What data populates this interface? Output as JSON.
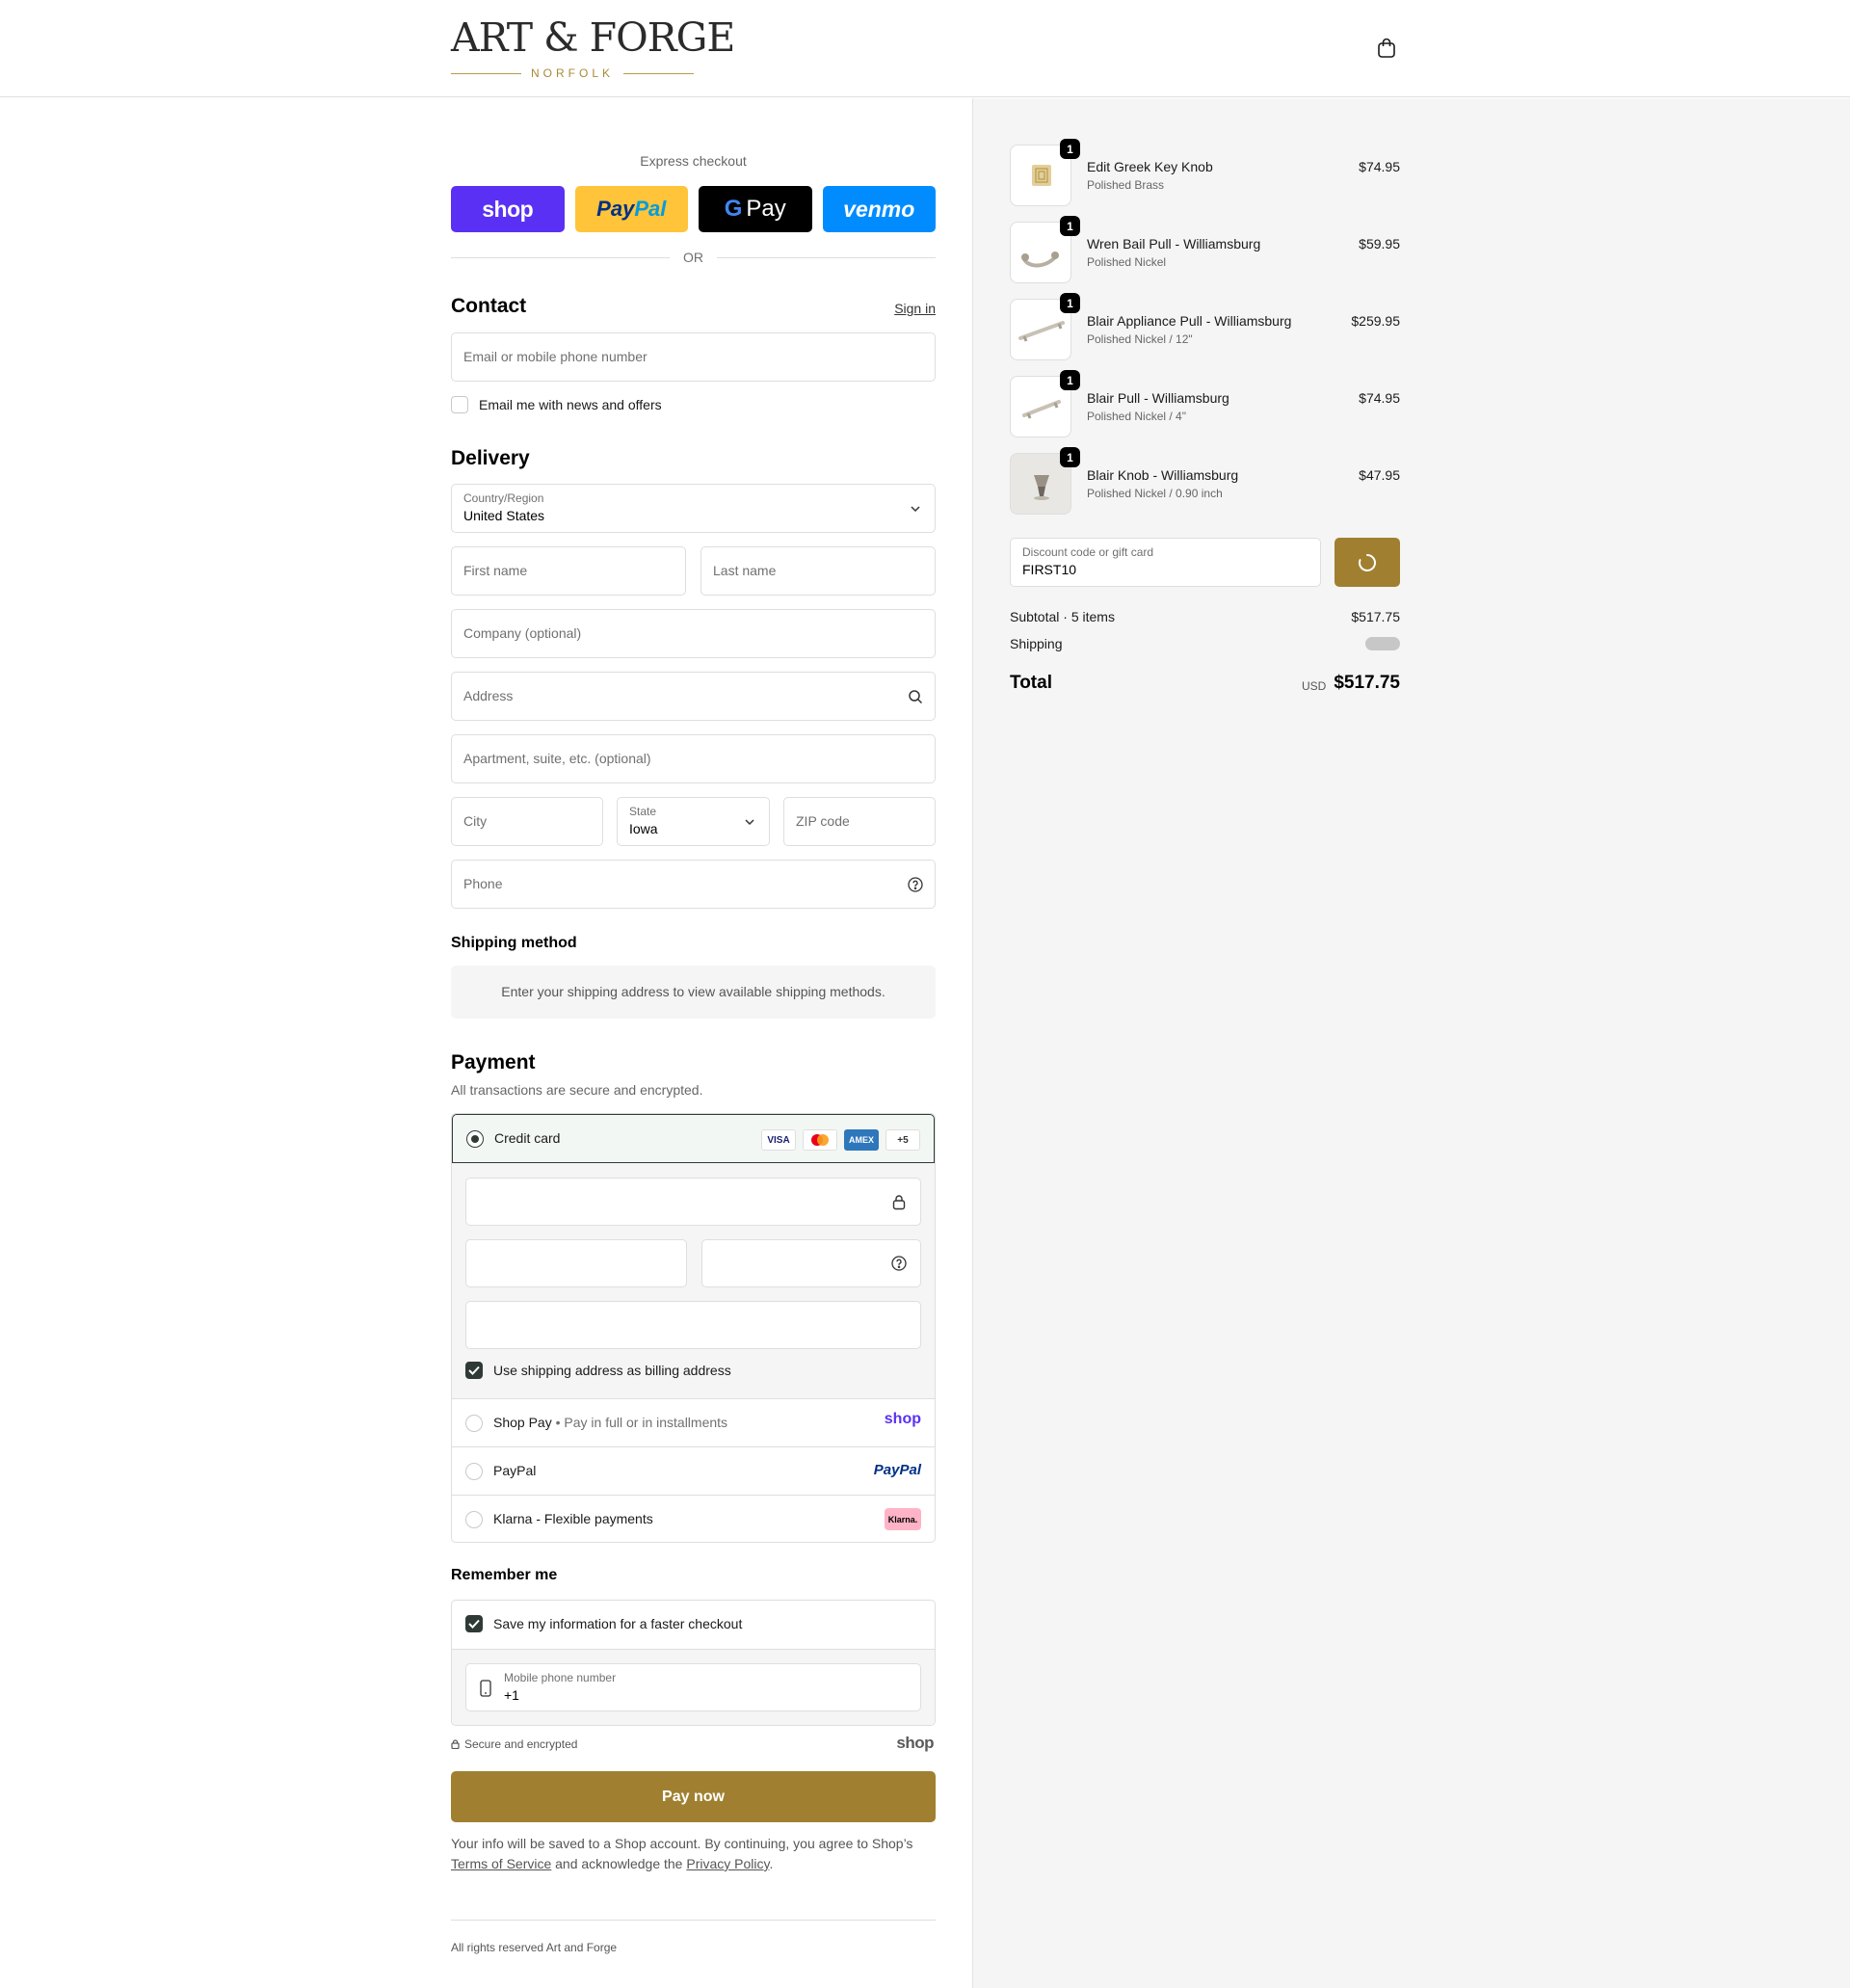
{
  "header": {
    "logo_main": "ART & FORGE",
    "logo_sub": "NORFOLK"
  },
  "express": {
    "title": "Express checkout",
    "buttons": [
      "shop",
      "PayPal",
      "G Pay",
      "venmo"
    ],
    "or": "OR"
  },
  "contact": {
    "title": "Contact",
    "sign_in": "Sign in",
    "email_placeholder": "Email or mobile phone number",
    "news_label": "Email me with news and offers"
  },
  "delivery": {
    "title": "Delivery",
    "country_label": "Country/Region",
    "country_value": "United States",
    "first_name": "First name",
    "last_name": "Last name",
    "company": "Company (optional)",
    "address": "Address",
    "apartment": "Apartment, suite, etc. (optional)",
    "city": "City",
    "state_label": "State",
    "state_value": "Iowa",
    "zip": "ZIP code",
    "phone": "Phone"
  },
  "shipping": {
    "title": "Shipping method",
    "note": "Enter your shipping address to view available shipping methods."
  },
  "payment": {
    "title": "Payment",
    "subtitle": "All transactions are secure and encrypted.",
    "credit_card": "Credit card",
    "card_brands": [
      "VISA",
      "MC",
      "AMEX",
      "+5"
    ],
    "billing_label": "Use shipping address as billing address",
    "shop_pay": "Shop Pay",
    "shop_pay_sub": "Pay in full or in installments",
    "shop_pay_logo": "shop",
    "paypal": "PayPal",
    "paypal_logo": "PayPal",
    "klarna": "Klarna - Flexible payments",
    "klarna_logo": "Klarna."
  },
  "remember": {
    "title": "Remember me",
    "save_label": "Save my information for a faster checkout",
    "mobile_label": "Mobile phone number",
    "mobile_value": "+1"
  },
  "footer": {
    "secure": "Secure and encrypted",
    "shop_logo": "shop",
    "pay_now": "Pay now",
    "terms_1": "Your info will be saved to a Shop account. By continuing, you agree to Shop’s",
    "terms_link": "Terms of Service",
    "terms_2": "and acknowledge the",
    "privacy_link": "Privacy Policy",
    "terms_end": ".",
    "rights": "All rights reserved Art and Forge"
  },
  "summary": {
    "items": [
      {
        "name": "Edit Greek Key Knob",
        "variant": "Polished Brass",
        "price": "$74.95",
        "qty": "1"
      },
      {
        "name": "Wren Bail Pull - Williamsburg",
        "variant": "Polished Nickel",
        "price": "$59.95",
        "qty": "1"
      },
      {
        "name": "Blair Appliance Pull - Williamsburg",
        "variant": "Polished Nickel / 12\"",
        "price": "$259.95",
        "qty": "1"
      },
      {
        "name": "Blair Pull - Williamsburg",
        "variant": "Polished Nickel / 4\"",
        "price": "$74.95",
        "qty": "1"
      },
      {
        "name": "Blair Knob - Williamsburg",
        "variant": "Polished Nickel / 0.90 inch",
        "price": "$47.95",
        "qty": "1"
      }
    ],
    "discount_label": "Discount code or gift card",
    "discount_value": "FIRST10",
    "subtotal_label": "Subtotal · 5 items",
    "subtotal_value": "$517.75",
    "shipping_label": "Shipping",
    "total_label": "Total",
    "total_currency": "USD",
    "total_value": "$517.75"
  },
  "colors": {
    "accent": "#a08030",
    "shop_purple": "#5a31f4",
    "paypal_yellow": "#ffc439",
    "venmo_blue": "#008cff"
  }
}
